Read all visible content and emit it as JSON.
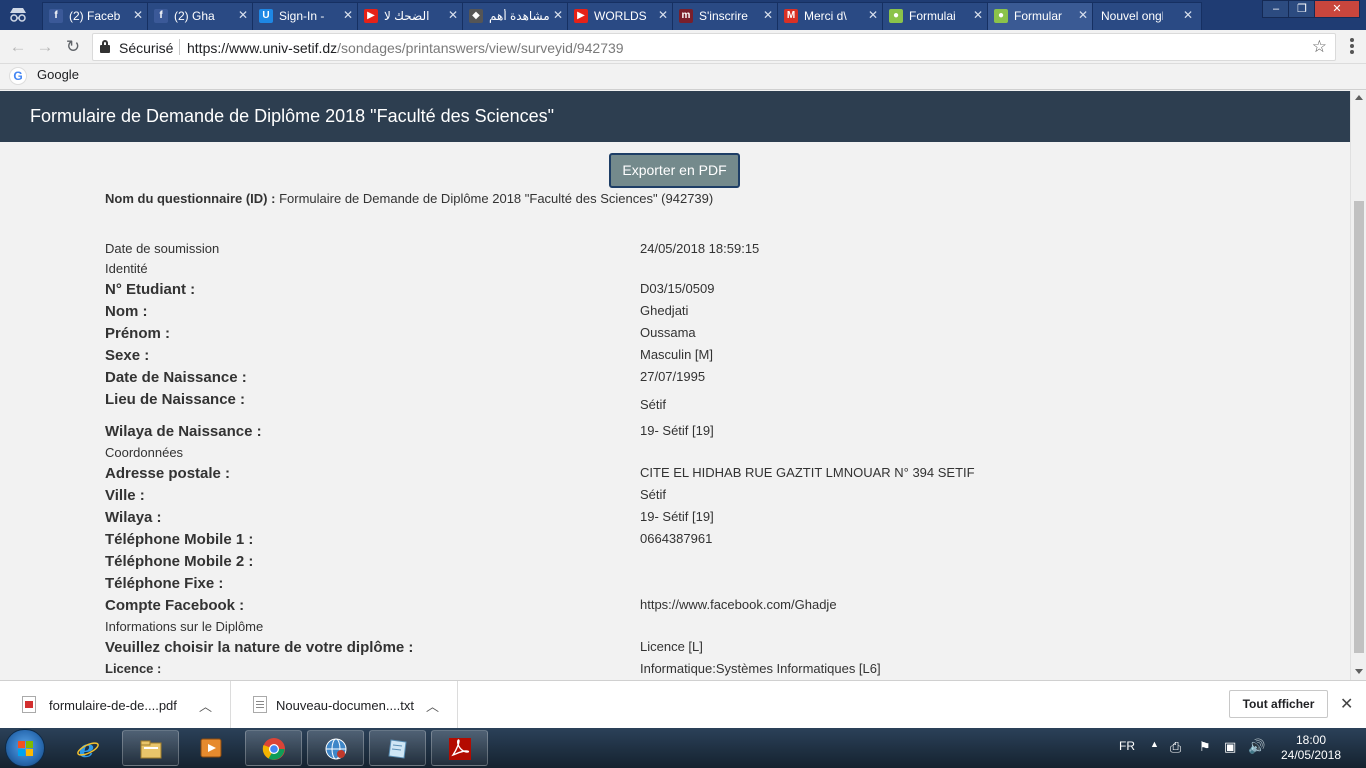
{
  "browser": {
    "tabs": [
      {
        "title": "(2) Faceb",
        "favicon": "facebook",
        "color": "#3b5998",
        "glyph": "f"
      },
      {
        "title": "(2) Gha",
        "favicon": "facebook",
        "color": "#3b5998",
        "glyph": "f"
      },
      {
        "title": "Sign-In -",
        "favicon": "u-logo",
        "color": "#1e88e5",
        "glyph": "U"
      },
      {
        "title": "الضحك لا",
        "favicon": "youtube",
        "color": "#e62117",
        "glyph": "▶"
      },
      {
        "title": "مشاهدة أهم",
        "favicon": "dark-logo",
        "color": "#555555",
        "glyph": "◆"
      },
      {
        "title": "WORLDS",
        "favicon": "youtube",
        "color": "#e62117",
        "glyph": "▶"
      },
      {
        "title": "S'inscrire",
        "favicon": "dark-logo",
        "color": "#7a1f2b",
        "glyph": "m"
      },
      {
        "title": "Merci d\\",
        "favicon": "gmail",
        "color": "#d93025",
        "glyph": "M"
      },
      {
        "title": "Formulai",
        "favicon": "limesurvey",
        "color": "#8bc34a",
        "glyph": "●"
      },
      {
        "title": "Formular",
        "favicon": "limesurvey",
        "color": "#8bc34a",
        "glyph": "●",
        "active": true
      },
      {
        "title": "Nouvel ongle",
        "favicon": "none",
        "color": "",
        "glyph": ""
      }
    ],
    "address": {
      "secure_label": "Sécurisé",
      "url_host": "https://www.univ-setif.dz",
      "url_path": "/sondages/printanswers/view/surveyid/942739"
    },
    "bookmarks": [
      {
        "label": "Google",
        "icon": "google-icon"
      }
    ]
  },
  "page": {
    "header_title": "Formulaire de Demande de Diplôme 2018 \"Faculté des Sciences\"",
    "export_button": "Exporter en PDF",
    "id_label": "Nom du questionnaire (ID) :",
    "id_value": "Formulaire de Demande de Diplôme 2018 \"Faculté des Sciences\" (942739)",
    "submission_label": "Date de soumission",
    "submission_value": "24/05/2018 18:59:15",
    "sections": {
      "identite": "Identité",
      "coordonnees": "Coordonnées",
      "diplome": "Informations sur le Diplôme"
    },
    "fields": {
      "etudiant": {
        "label": "N° Etudiant :",
        "value": "D03/15/0509"
      },
      "nom": {
        "label": "Nom :",
        "value": "Ghedjati"
      },
      "prenom": {
        "label": "Prénom :",
        "value": "Oussama"
      },
      "sexe": {
        "label": "Sexe :",
        "value": "Masculin [M]"
      },
      "date_naissance": {
        "label": "Date de Naissance :",
        "value": "27/07/1995"
      },
      "lieu_naissance": {
        "label": "Lieu de Naissance :",
        "value": "Sétif"
      },
      "wilaya_naissance": {
        "label": "Wilaya de Naissance :",
        "value": "19- Sétif [19]"
      },
      "adresse": {
        "label": "Adresse postale :",
        "value": "CITE EL HIDHAB RUE GAZTIT LMNOUAR N° 394 SETIF"
      },
      "ville": {
        "label": "Ville :",
        "value": "Sétif"
      },
      "wilaya": {
        "label": "Wilaya :",
        "value": "19- Sétif [19]"
      },
      "tel1": {
        "label": "Téléphone  Mobile 1 :",
        "value": "0664387961"
      },
      "tel2": {
        "label": "Téléphone  Mobile 2 :",
        "value": ""
      },
      "telfixe": {
        "label": "Téléphone Fixe :",
        "value": ""
      },
      "facebook": {
        "label": "Compte Facebook :",
        "value": "https://www.facebook.com/Ghadje"
      },
      "nature": {
        "label": "Veuillez choisir la nature de votre diplôme :",
        "value": "Licence [L]"
      },
      "licence": {
        "label": "Licence :",
        "value": "Informatique:Systèmes Informatiques [L6]"
      }
    }
  },
  "downloads": {
    "items": [
      {
        "name": "formulaire-de-de....pdf",
        "type": "pdf"
      },
      {
        "name": "Nouveau-documen....txt",
        "type": "txt"
      }
    ],
    "show_all": "Tout afficher"
  },
  "taskbar": {
    "apps": [
      "explorer",
      "internet-explorer",
      "file-manager",
      "media-player",
      "chrome",
      "network-tool",
      "notepad",
      "acrobat"
    ],
    "language": "FR",
    "time": "18:00",
    "date": "24/05/2018"
  }
}
